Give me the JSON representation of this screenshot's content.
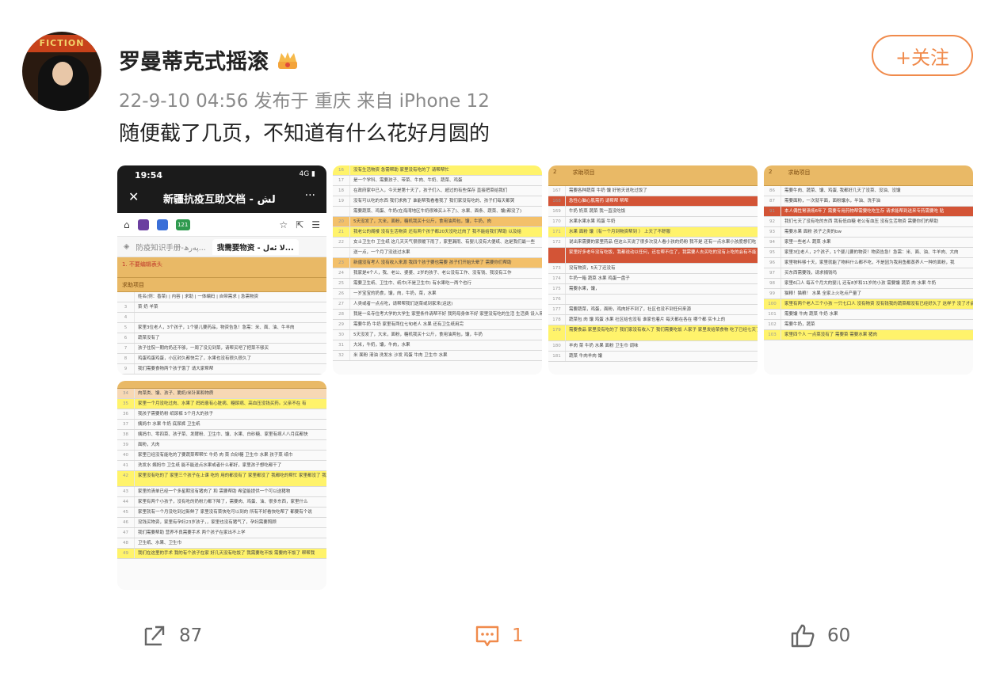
{
  "post": {
    "username": "罗曼蒂克式摇滚",
    "avatar_banner": "FICTION",
    "timestamp": "22-9-10 04:56",
    "location_prefix": "发布于",
    "location": "重庆",
    "source_prefix": "来自",
    "source": "iPhone 12",
    "text": "随便截了几页，不知道有什么花好月圆的",
    "follow_label": "+关注"
  },
  "thumb1": {
    "time": "19:54",
    "status": "4G",
    "close": "✕",
    "title": "新疆抗疫互助文档 - لش",
    "more": "···",
    "tabs": [
      "防疫知识手册-پەرھ...",
      "我需要物资 - لا ئەل..."
    ],
    "badge": "121",
    "header": "1. 不要编辑表头",
    "col_header": "求助项目",
    "rows": [
      {
        "num": "",
        "text": "姓名(例：香菜) | 内容 | 求助 | 一体编码 | 自带需求 | 急需物资"
      },
      {
        "num": "3",
        "text": "菜  奶  羊菜"
      },
      {
        "num": "4",
        "text": ""
      },
      {
        "num": "5",
        "text": "家里3位老人，3个孩子，1个婴儿要药品，物资告急！急需：米、面、油、牛羊肉"
      },
      {
        "num": "6",
        "text": "蔬菜没有了"
      },
      {
        "num": "7",
        "text": "孩子住院一期的奶还不够，一周了没见到菜，请帮买吧了把菜不够买"
      },
      {
        "num": "8",
        "text": "鸡蛋鸡蛋鸡蛋，小区封久都快完了，水果也没有很久很久了"
      },
      {
        "num": "9",
        "text": "我们需要食物两个孩子饿了 请大家帮帮"
      }
    ]
  },
  "thumb2": {
    "rows": [
      {
        "num": "16",
        "text": "没有生活物资 急需帮助 家里没有吃的了 请帮帮忙",
        "style": "yellow"
      },
      {
        "num": "17",
        "text": "是一个学科、需要孩子、带菜、牛肉、牛奶、蔬菜、鸡蛋"
      },
      {
        "num": "18",
        "text": "在政府家中已入，今天是第十天了，孩子们入、超过的有些保存 直接把菜给我们"
      },
      {
        "num": "19",
        "text": "没有可以吃的东西 我们求救了 谁能帮我看看我了 我们家没有吃的、孩子们每天都哭"
      },
      {
        "num": "",
        "text": "需要蔬菜、鸡蛋、牛奶(在海湾地区牛奶很难买上不了)、水果、面条、蔬菜、馕(都没了)"
      },
      {
        "num": "20",
        "text": "5天没发了，大米，面粉，糖机我买十公斤，食用油两包，馕，牛奶，肉",
        "style": "orange"
      },
      {
        "num": "21",
        "text": "我老公的阁楼 没有生活物资 还有两个孩子都20天没吃过肉了 我不能给我们帮助 以及给",
        "style": "yellow"
      },
      {
        "num": "22",
        "text": "女士卫生巾 卫生纸 这几天天气很很暖下雨了，家里漏雨、有婴儿没有大便纸、这是我们最一些"
      },
      {
        "num": "",
        "text": "送一点，一个月了没送过水果"
      },
      {
        "num": "23",
        "text": "新疆没有考人 没有收入来源 我四个孩子要也需要 孩子们开始头晕了 需要你们帮助",
        "style": "orange"
      },
      {
        "num": "24",
        "text": "我家是4个人，我、老公、婆婆、2岁的孩子、老公没有工作、没有钱、我没有工作"
      },
      {
        "num": "25",
        "text": "需要卫生纸、卫生巾、纸巾(不是卫生巾) 有水果吃一两个也行"
      },
      {
        "num": "26",
        "text": "一岁宝宝的奶食，馕，肉，牛奶，菜，水果"
      },
      {
        "num": "27",
        "text": "人类或者一点点吃，请帮帮我们送菜或到家来(运送)"
      },
      {
        "num": "28",
        "text": "我是一名寺住考大学的大学生 家里条件请帮不好 我阿母身体不好 家里没有吃的生活 生活费 设入来源"
      },
      {
        "num": "29",
        "text": "需要牛奶 牛奶 家里有两位七旬老人 水果 还有卫生纸用完"
      },
      {
        "num": "30",
        "text": "5天没发了，大米，面粉，糖机我买十公斤，食用油两包，馕，牛奶"
      },
      {
        "num": "31",
        "text": "大米，牛奶，馕，牛肉，水果"
      },
      {
        "num": "32",
        "text": "米 面粉 清油 洗发水 沙发 鸡蛋 牛肉 卫生巾 水果"
      }
    ]
  },
  "thumb3": {
    "header_num": "2",
    "header": "求助项目",
    "rows": [
      {
        "num": "167",
        "text": "需要各种蔬菜 牛奶 馕 好他天说吃过饭了"
      },
      {
        "num": "168",
        "text": "急性心脑心肌需药 请帮帮 帮帮",
        "style": "red"
      },
      {
        "num": "169",
        "text": "牛奶 奶菜 蔬菜 我一直没吃饭"
      },
      {
        "num": "170",
        "text": "水果水果水果 鸡蛋 牛奶"
      },
      {
        "num": "171",
        "text": "水果 面粉 馕（有一个月到物资帮到 ） 上天了不舒服",
        "style": "yellow"
      },
      {
        "num": "172",
        "text": "说出来需要的家里药品 但这么天说了很多次没人看小孩的奶粉 我不是 还有一点水果小孩度想们吃 吃就这么完饿了"
      },
      {
        "num": "",
        "text": "家里好多老年没有吃饭，我都说动以任何，还在帮不住了，我需要人去买吃的没有上吃的会有不能 关于大家，45天了没有能够不能来送大家食物给帮助需要帮助",
        "style": "red"
      },
      {
        "num": "173",
        "text": "没有物资，5天了还没有"
      },
      {
        "num": "174",
        "text": "牛奶一箱 蔬菜 水果 鸡蛋一盘子"
      },
      {
        "num": "175",
        "text": "需要水果，馕，"
      },
      {
        "num": "176",
        "text": ""
      },
      {
        "num": "177",
        "text": "需要蔬菜，鸡蛋，面粉，鸡肉好不到了，社区也没不到任何来源"
      },
      {
        "num": "178",
        "text": "蔬菜包 肉 馕 鸡蛋 水果 社区给也没有 谁家也着片 每天都在各在 哪个都 实卡上的"
      },
      {
        "num": "179",
        "text": "需要食品 家里没有吃的了 我们家没有收入了 我们需要吃饭 人家子 家里发给菜食物 吃了已经七天了 一点吃的都没有了 请帮帮我们 大家请求帮助",
        "style": "yellow"
      },
      {
        "num": "180",
        "text": "羊肉 菜 牛奶 水果 面粉 卫生巾 调味"
      },
      {
        "num": "181",
        "text": "蔬菜 牛肉羊肉 馕"
      }
    ]
  },
  "thumb4": {
    "header_num": "2",
    "header": "求助项目",
    "rows": [
      {
        "num": "86",
        "text": "需要牛肉、蔬菜、馕、鸡蛋, 我都好几天了没菜、没油、没馕"
      },
      {
        "num": "87",
        "text": "需要面粉，一次就平面，面粉馕水，半油、洗手油"
      },
      {
        "num": "91",
        "text": "本人偶性胃溃疡6年了 需要专用药物帮需要吃吃生存 请求能帮到送来专药需要吃 贴",
        "style": "red"
      },
      {
        "num": "92",
        "text": "我们七天了没有吃的东西 我有低血糖 老公有血压 没有生活物资 需要你们的帮助"
      },
      {
        "num": "93",
        "text": "需要水果 面粉 孩子之类的bw"
      },
      {
        "num": "94",
        "text": "家里一些老人 蔬菜 水果"
      },
      {
        "num": "95",
        "text": "家里3位老人，2个孩子，1个婴儿要的物资！物资告急！急需：米、面、油、牛羊肉、大肉"
      },
      {
        "num": "96",
        "text": "家里物料够十天，家里就能了物料什么都不吃，不是因为我用鱼都蒸养人一种的面粉，我"
      },
      {
        "num": "97",
        "text": "买东西需要钱，请求捐钱吗"
      },
      {
        "num": "98",
        "text": "家里6口人 每五个月大的婴儿 还有8岁和11岁的小孩 需要馕 蔬菜 肉 水果 牛奶"
      },
      {
        "num": "99",
        "text": "猫粮！猫粮！       水果 全家上火吃点产量了"
      },
      {
        "num": "100",
        "text": "家里有两个老人三个小孩 一只七口人 没有物资 没有钱我的蔬菜都没有已经好久了 这样子 没了才会要都",
        "style": "yellow"
      },
      {
        "num": "101",
        "text": "需要馕 牛肉 蔬菜 牛奶 水果"
      },
      {
        "num": "102",
        "text": "需要牛奶，蔬菜"
      },
      {
        "num": "103",
        "text": "家里四个人  一点菜没有了 需要菜  需要水果  猪肉",
        "style": "yellow"
      }
    ]
  },
  "thumb5": {
    "rows": [
      {
        "num": "34",
        "text": "肉菜类、馕、孩子、脆奶/米针面和物质",
        "style": "peach"
      },
      {
        "num": "35",
        "text": "家里一个月没吃过肉、水果了 妈妈患有心脏病、糖尿病、高血压没钱买药。父亲不在 有",
        "style": "yellow"
      },
      {
        "num": "36",
        "text": "我孩子需要奶粉 纸尿裤 5个月大的孩子"
      },
      {
        "num": "37",
        "text": "姨妈巾  水果  牛奶  底尿裤  卫生纸"
      },
      {
        "num": "38",
        "text": "姨妈巾、零四菜、孩子菜、发酵粉、卫生巾、馕、水果、白砂糖、家里有病人八月底都快"
      },
      {
        "num": "39",
        "text": "面粉，大肉"
      },
      {
        "num": "40",
        "text": "家里已经没有能吃的了要蔬菜帮帮忙 牛奶 肉 菜 白砂糖 卫生巾 水果 孩子菜 纸巾"
      },
      {
        "num": "41",
        "text": "洗发水 姨妈巾 卫生纸 能不能送点水果或者什么都好，家里孩子想吃都干了"
      },
      {
        "num": "42",
        "text": "家里没有吃的了 家里三个孩子在上课 吃的 用的都没有了 家里都没了 我都吃的帮忙 家里都没了 我们人员可以帮我们 已经15天了 我们也没有 大米吃没有 需要也没了 我们们都",
        "style": "yellow"
      },
      {
        "num": "43",
        "text": "家里的清单已经一个多星期没有猪肉了 和 需要帮助 希望能提供一个可以送猪物"
      },
      {
        "num": "44",
        "text": "家里有两个小孩子，没有吃的奶粉力都下降了，需要肉、鸡蛋、油、很多东西，家里什么"
      },
      {
        "num": "45",
        "text": "家里就有一个月没吃到过新鲜了 家里没有菜快吃可以到的 所有不好看快吃帮了 都要有个说"
      },
      {
        "num": "46",
        "text": "没钱买物资，家里有孕妇23岁孩子，，家里也没有猪气了，孕妇需要照顾"
      },
      {
        "num": "47",
        "text": "我们需要帮助 营养不良需要手术 两个孩子在家出不上学"
      },
      {
        "num": "48",
        "text": "卫生纸、水果、卫生巾"
      },
      {
        "num": "49",
        "text": "我们在这里的手术 我的有个孩子在家 好几天没有吃饭了 我需要吃不饭 需要的不饭了 帮帮我",
        "style": "yellow"
      }
    ]
  },
  "actions": {
    "repost_count": "87",
    "comment_count": "1",
    "like_count": "60"
  },
  "colors": {
    "accent": "#f08a4b",
    "sheet_header": "#e9b966",
    "highlight_yellow": "#fff36b",
    "highlight_red": "#d35436"
  }
}
